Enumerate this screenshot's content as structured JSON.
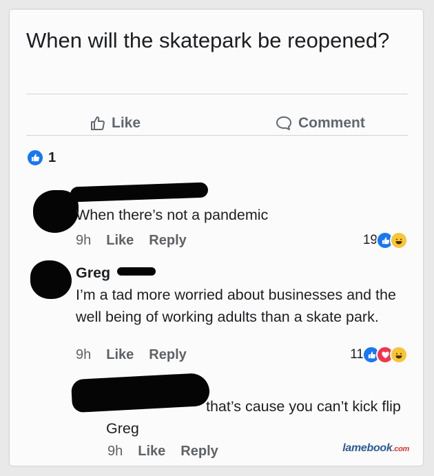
{
  "post": {
    "text": "When will the skatepark be reopened?"
  },
  "actions": {
    "like_label": "Like",
    "comment_label": "Comment"
  },
  "reactions": {
    "count": "1"
  },
  "comments": [
    {
      "author": "",
      "text": "When there’s not a pandemic",
      "time": "9h",
      "like_label": "Like",
      "reply_label": "Reply",
      "reaction_count": "19"
    },
    {
      "author": "Greg",
      "text": "I’m a tad more worried about businesses and the well being of working adults than a skate park.",
      "time": "9h",
      "like_label": "Like",
      "reply_label": "Reply",
      "reaction_count": "11"
    },
    {
      "author": "",
      "text": "that’s cause you can’t kick flip Greg",
      "time": "9h",
      "like_label": "Like",
      "reply_label": "Reply"
    }
  ],
  "watermark": {
    "text": "lamebook",
    "suffix": ".com"
  },
  "colors": {
    "like_blue": "#1877f2",
    "love_red": "#f0354c",
    "haha_yellow": "#f7c536"
  }
}
